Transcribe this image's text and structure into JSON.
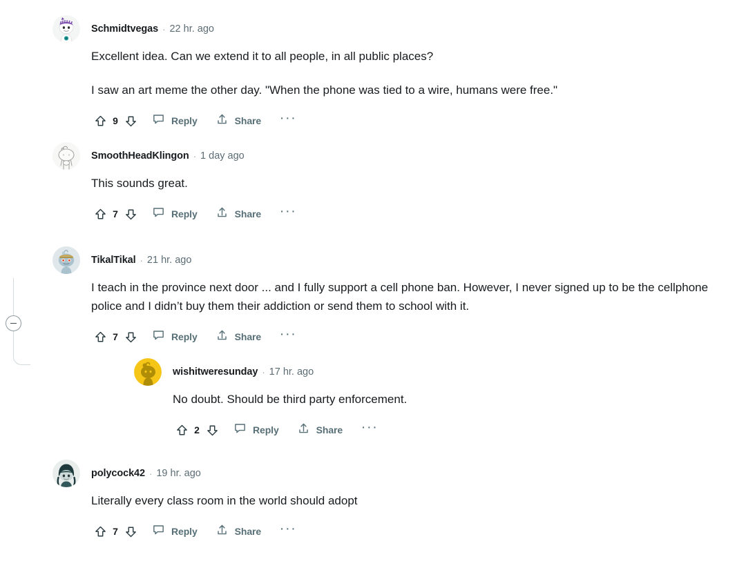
{
  "app": {
    "name": "reddit-comment-thread",
    "accent_color": "#0079d3",
    "text_color": "#181c1f",
    "meta_color": "#5c6c74",
    "action_color": "#576f76",
    "thread_line_color": "#d2dadd"
  },
  "actions": {
    "upvote_name": "upvote-icon",
    "downvote_name": "downvote-icon",
    "reply_label": "Reply",
    "share_label": "Share",
    "more_label": "···"
  },
  "comments": [
    {
      "id": "c1",
      "author": "Schmidtvegas",
      "separator": "·",
      "time": "22 hr. ago",
      "score": "9",
      "avatar": "snoo-purple-hair",
      "paragraphs": [
        "Excellent idea. Can we extend it to all people, in all public places?",
        "I saw an art meme the other day. \"When the phone was tied to a wire, humans were free.\""
      ],
      "replies": []
    },
    {
      "id": "c2",
      "author": "SmoothHeadKlingon",
      "separator": "·",
      "time": "1 day ago",
      "score": "7",
      "avatar": "snoo-white-sketch",
      "paragraphs": [
        "This sounds great."
      ],
      "replies": []
    },
    {
      "id": "c3",
      "author": "TikalTikal",
      "separator": "·",
      "time": "21 hr. ago",
      "score": "7",
      "avatar": "snoo-blue-hat",
      "paragraphs": [
        "I teach in the province next door ... and I fully support a cell phone ban. However, I never signed up to be the cellphone police and I didn’t buy them their addiction or send them to school with it."
      ],
      "replies": [
        {
          "id": "c3r1",
          "author": "wishitweresunday",
          "separator": "·",
          "time": "17 hr. ago",
          "score": "2",
          "avatar": "snoo-gold",
          "paragraphs": [
            "No doubt. Should be third party enforcement."
          ]
        }
      ]
    },
    {
      "id": "c4",
      "author": "polycock42",
      "separator": "·",
      "time": "19 hr. ago",
      "score": "7",
      "avatar": "snoo-dark-hood",
      "paragraphs": [
        "Literally every class room in the world should adopt"
      ],
      "replies": []
    }
  ]
}
